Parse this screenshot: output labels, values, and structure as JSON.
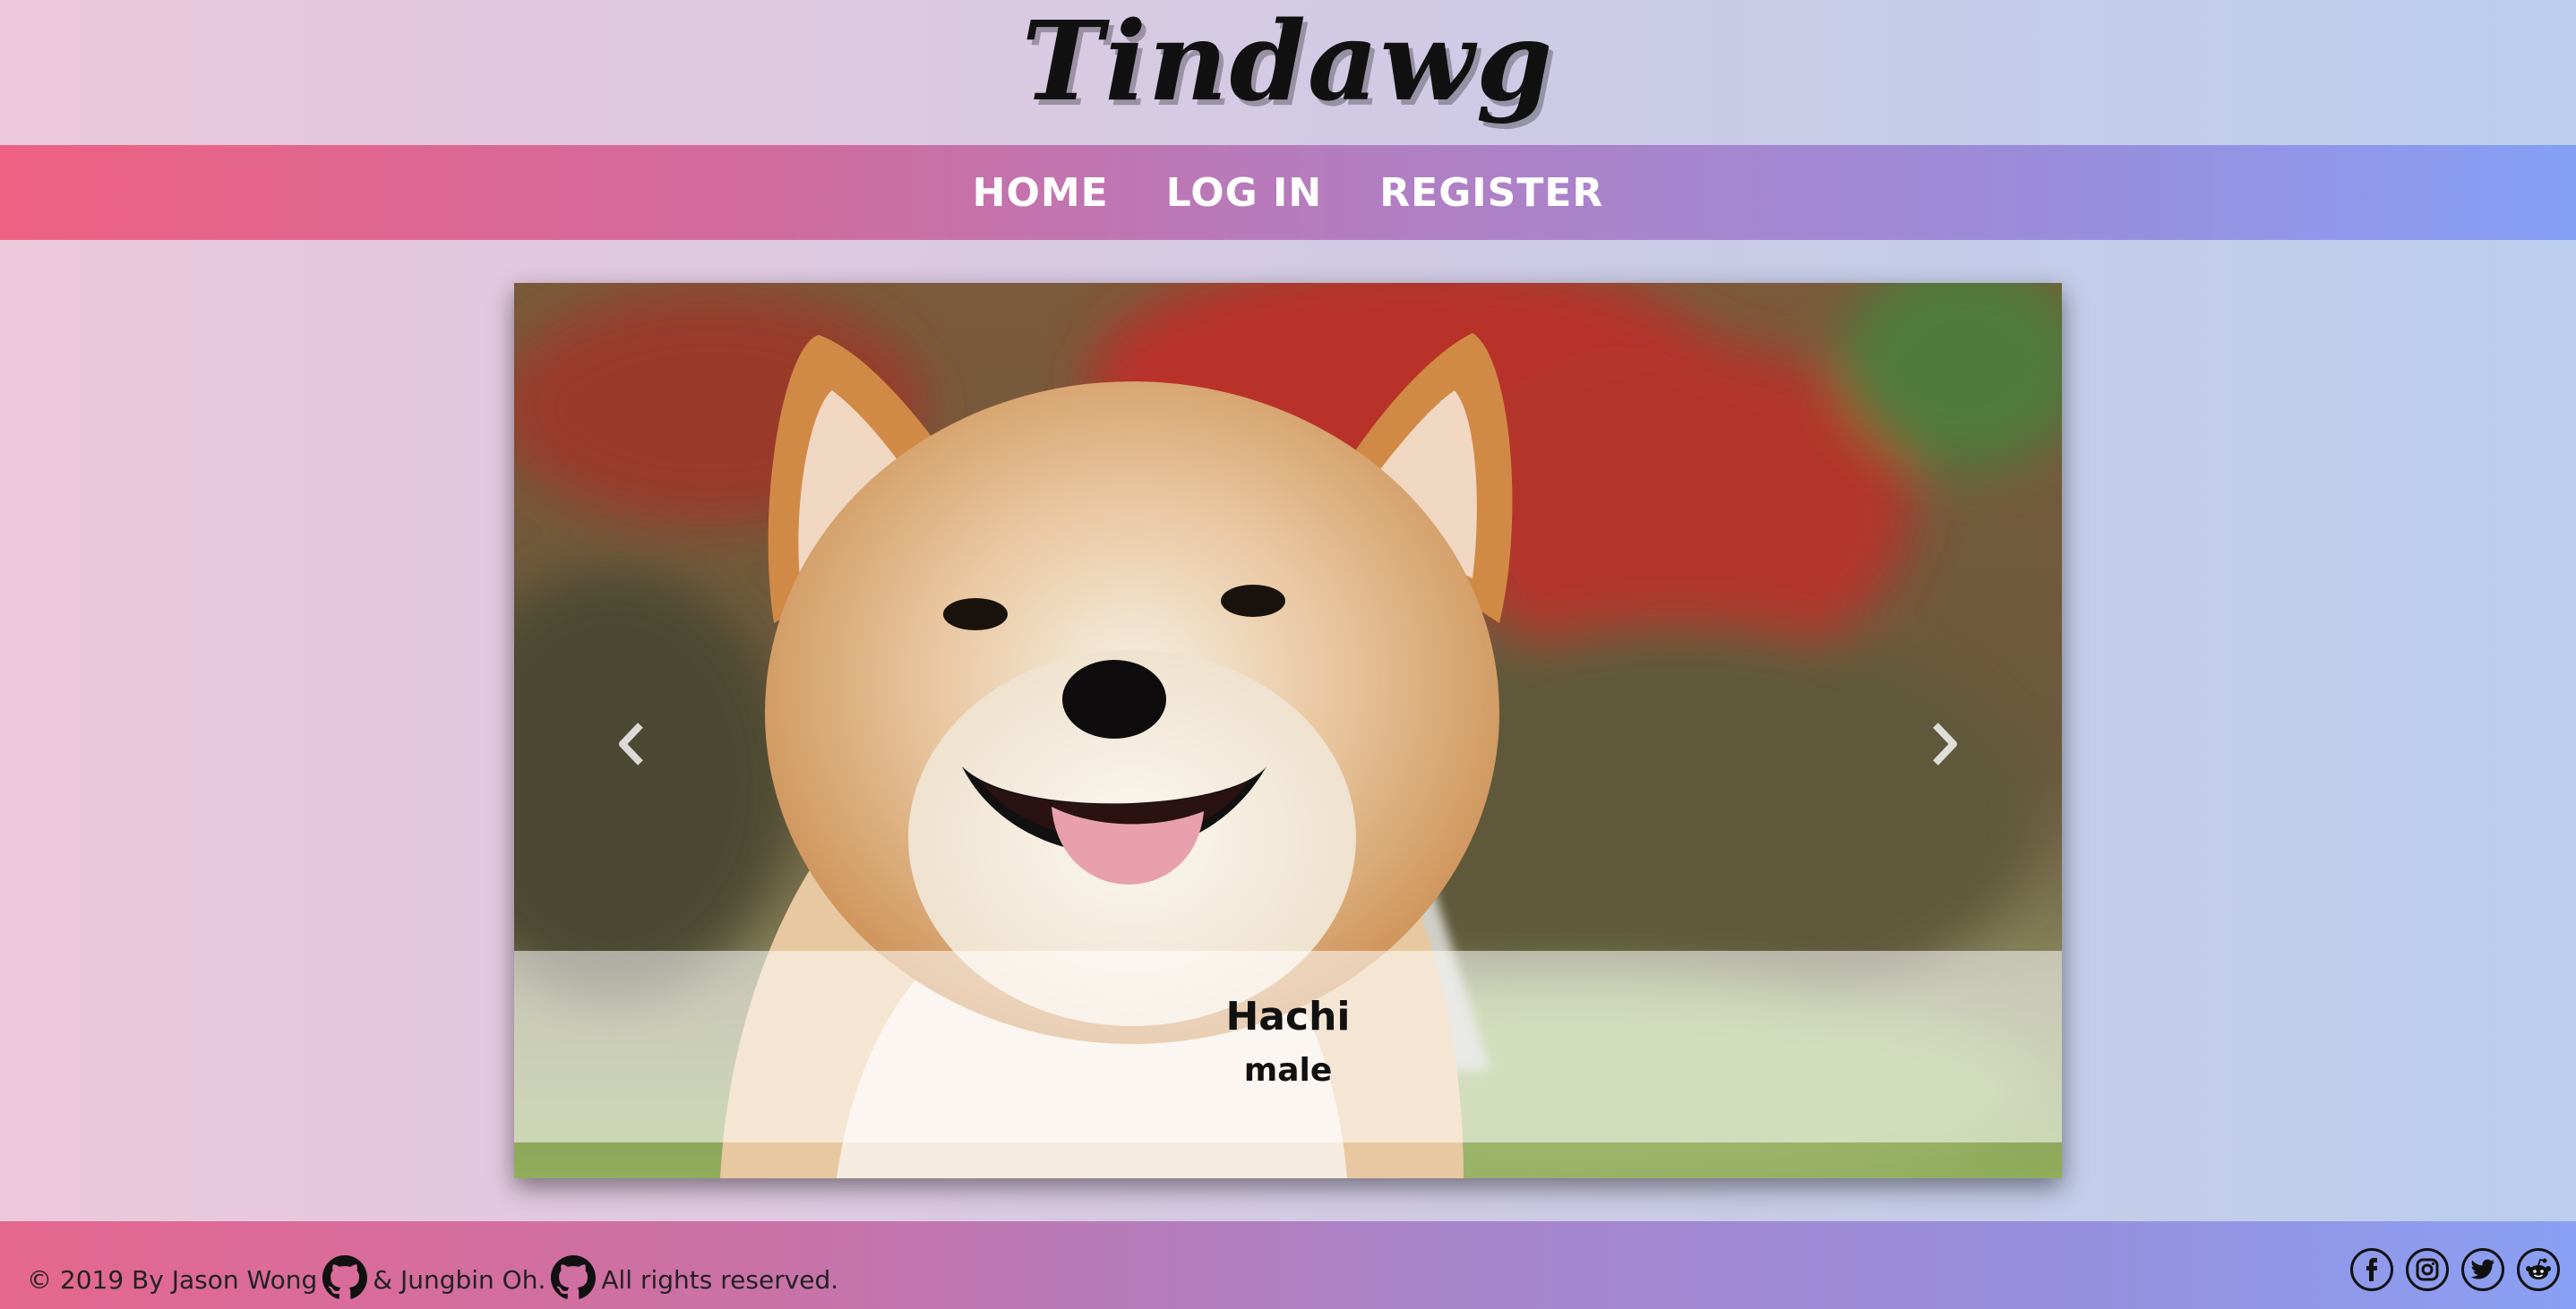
{
  "header": {
    "logo": "Tindawg"
  },
  "nav": {
    "items": [
      {
        "label": "HOME"
      },
      {
        "label": "LOG IN"
      },
      {
        "label": "REGISTER"
      }
    ]
  },
  "carousel": {
    "slide": {
      "name": "Hachi",
      "gender": "male"
    },
    "prev_icon": "chevron-left-icon",
    "next_icon": "chevron-right-icon"
  },
  "footer": {
    "copyright": "© 2019 By Jason Wong",
    "connector": "& Jungbin Oh.",
    "rights": "All rights reserved.",
    "social": [
      "facebook-icon",
      "instagram-icon",
      "twitter-icon",
      "reddit-icon"
    ]
  },
  "colors": {
    "nav_gradient_start": "#ee6183",
    "nav_gradient_end": "#86a0f6",
    "text_dark": "#111111"
  }
}
